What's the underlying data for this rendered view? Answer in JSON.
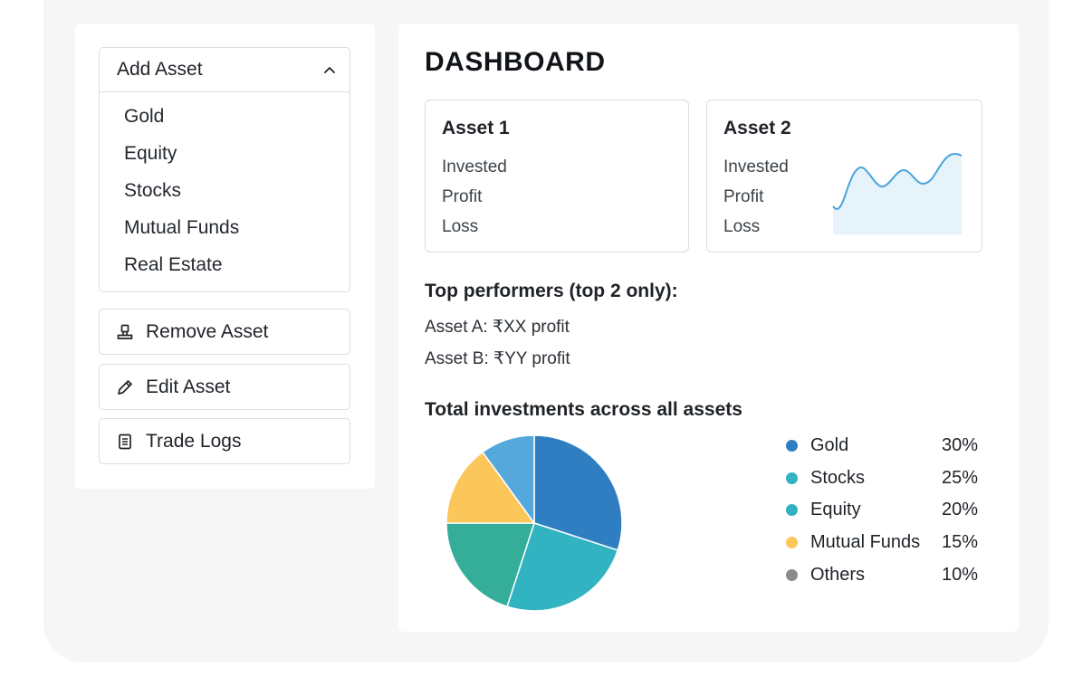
{
  "sidebar": {
    "add_asset": {
      "title": "Add Asset",
      "options": [
        "Gold",
        "Equity",
        "Stocks",
        "Mutual Funds",
        "Real Estate"
      ]
    },
    "buttons": {
      "remove": {
        "label": "Remove Asset",
        "icon": "stamp-icon"
      },
      "edit": {
        "label": "Edit Asset",
        "icon": "pencil-icon"
      },
      "trade_logs": {
        "label": "Trade Logs",
        "icon": "document-icon"
      }
    }
  },
  "main": {
    "title": "DASHBOARD",
    "cards": [
      {
        "title": "Asset 1",
        "rows": [
          "Invested",
          "Profit",
          "Loss"
        ]
      },
      {
        "title": "Asset 2",
        "rows": [
          "Invested",
          "Profit",
          "Loss"
        ]
      }
    ],
    "top_performers": {
      "title": "Top performers (top 2 only):",
      "items": [
        "Asset A: ₹XX profit",
        "Asset B: ₹YY profit"
      ]
    },
    "allocation_title": "Total investments across all assets"
  },
  "chart_data": {
    "type": "pie",
    "categories": [
      "Gold",
      "Stocks",
      "Equity",
      "Mutual Funds",
      "Others"
    ],
    "values": [
      30,
      25,
      20,
      15,
      10
    ],
    "value_labels": [
      "30%",
      "25%",
      "20%",
      "15%",
      "10%"
    ],
    "colors": [
      "#2f7ec1",
      "#31b3c2",
      "#33b0c0",
      "#fbc65a",
      "#8a8a8a"
    ],
    "slice_colors_drawn": [
      "#2f7ec1",
      "#31b3c2",
      "#34ae99",
      "#fbc65a",
      "#54a8db"
    ],
    "legend": "right"
  },
  "theme": {
    "spark_line": "#4aa3da",
    "spark_fill": "#e6f3fb"
  }
}
